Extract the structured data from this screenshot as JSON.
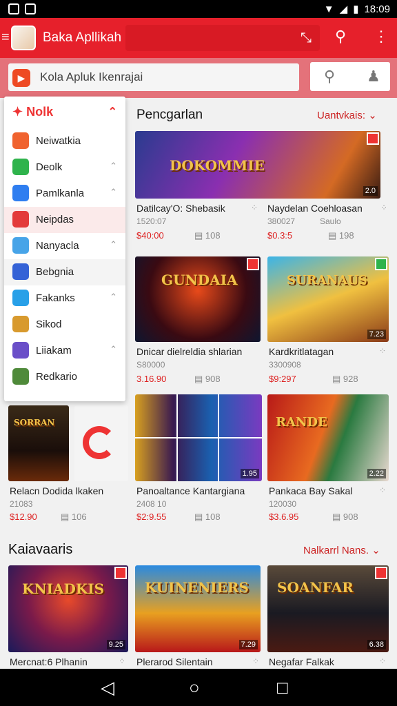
{
  "status_bar": {
    "time": "18:09"
  },
  "app_bar": {
    "title": "Baka Apllikah",
    "field_clear": "⤡"
  },
  "search": {
    "placeholder": "Kola Apluk Ikenrajai"
  },
  "drawer": {
    "header": "Nolk",
    "items": [
      {
        "label": "Neiwatkia",
        "color": "#f0632f"
      },
      {
        "label": "Deolk",
        "color": "#2fb34c"
      },
      {
        "label": "Pamlkanla",
        "color": "#2f7ef0"
      },
      {
        "label": "Neipdas",
        "color": "#e33a3a"
      },
      {
        "label": "Nanyacla",
        "color": "#47a4e8"
      },
      {
        "label": "Bebgnia",
        "color": "#3462d6"
      },
      {
        "label": "Fakanks",
        "color": "#28a0e8"
      },
      {
        "label": "Sikod",
        "color": "#d89a2e"
      },
      {
        "label": "Liiakam",
        "color": "#6a4fc8"
      },
      {
        "label": "Redkario",
        "color": "#4f8a3a"
      }
    ]
  },
  "section1": {
    "title": "Pencgarlan",
    "more": "Uantvkais:",
    "cards": [
      {
        "name": "Datilcay'O: Shebasik",
        "sub": "1520:07",
        "price": "$40:00",
        "count": "108",
        "overlay": "DOKOMMIE",
        "corner": "2.0"
      },
      {
        "name": "Naydelan Coehloasan",
        "sub": "380027",
        "sub2": "Saulo",
        "price": "$0.3:5",
        "count": "198"
      },
      {
        "name": "Dnicar dielreldia shlarian",
        "sub": "S80000",
        "price": "3.16.90",
        "count": "908",
        "overlay": "GUNDAIA"
      },
      {
        "name": "Kardkritlatagan",
        "sub": "3300908",
        "price": "$9:297",
        "count": "928",
        "overlay": "SURANAUS",
        "corner": "7.23"
      },
      {
        "name": "Relacn Dodida lkaken",
        "sub": "21083",
        "price": "$12.90",
        "count": "106",
        "overlay": "SORRAN"
      },
      {
        "name": "Panoaltance Kantargiana",
        "sub": "2408 10",
        "price": "$2:9.55",
        "count": "108",
        "corner": "1.95"
      },
      {
        "name": "Pankaca Bay Sakal",
        "sub": "120030",
        "price": "$3.6.95",
        "count": "908",
        "overlay": "RANDE",
        "corner": "2.22"
      }
    ]
  },
  "section2": {
    "title": "Kaiavaaris",
    "more": "Nalkarrl Nans.",
    "cards": [
      {
        "name": "Mercnat:6 Plhanin",
        "overlay": "KNIADKIS",
        "corner": "9.25"
      },
      {
        "name": "Plerarod Silentain",
        "overlay": "KUINENIERS",
        "corner": "7.29"
      },
      {
        "name": "Negafar Falkak",
        "overlay": "SOANFAR",
        "corner": "6.38"
      }
    ]
  }
}
